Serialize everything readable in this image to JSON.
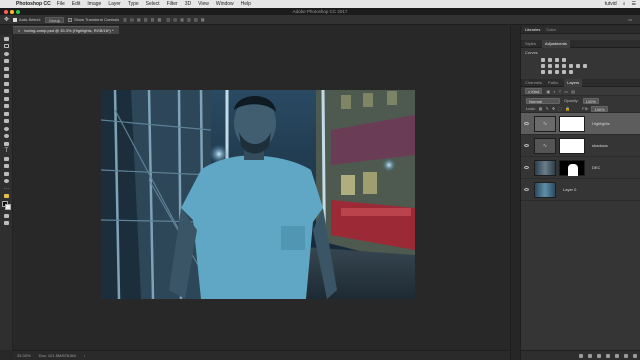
{
  "mac_menu": {
    "app": "Photoshop CC",
    "items": [
      "File",
      "Edit",
      "Image",
      "Layer",
      "Type",
      "Select",
      "Filter",
      "3D",
      "View",
      "Window",
      "Help"
    ],
    "status_right": "tutvid"
  },
  "window_title": "Adobe Photoshop CC 2017",
  "options_bar": {
    "auto_select": "Auto-Select:",
    "group": "Group",
    "show_transform": "Show Transform Controls"
  },
  "document_tab": "toning-comp.psd @ 33.3% (Highlights, RGB/16*) *",
  "status_bar": {
    "zoom": "33.33%",
    "doc": "Doc: 121.5M/878.6M"
  },
  "panels": {
    "top_tabs": [
      "Libraries",
      "Color"
    ],
    "adj_tabs": [
      "Styles",
      "Adjustments"
    ],
    "adj_title": "Curves",
    "layer_tabs": [
      "Channels",
      "Paths",
      "Layers"
    ],
    "filter_label": "Kind",
    "blend_mode": "Normal",
    "opacity_label": "Opacity:",
    "opacity_value": "100%",
    "lock_label": "Lock:",
    "fill_label": "Fill:",
    "fill_value": "100%",
    "layers": [
      {
        "name": "Highlights",
        "selected": true,
        "type": "adjustment"
      },
      {
        "name": "shadows",
        "selected": false,
        "type": "adjustment"
      },
      {
        "name": "DEC",
        "selected": false,
        "type": "photo-mask"
      },
      {
        "name": "Layer 0",
        "selected": false,
        "type": "photo"
      }
    ]
  },
  "colors": {
    "accent": "#2d8ceb",
    "panel_bg": "#353535",
    "canvas_bg": "#282828"
  }
}
